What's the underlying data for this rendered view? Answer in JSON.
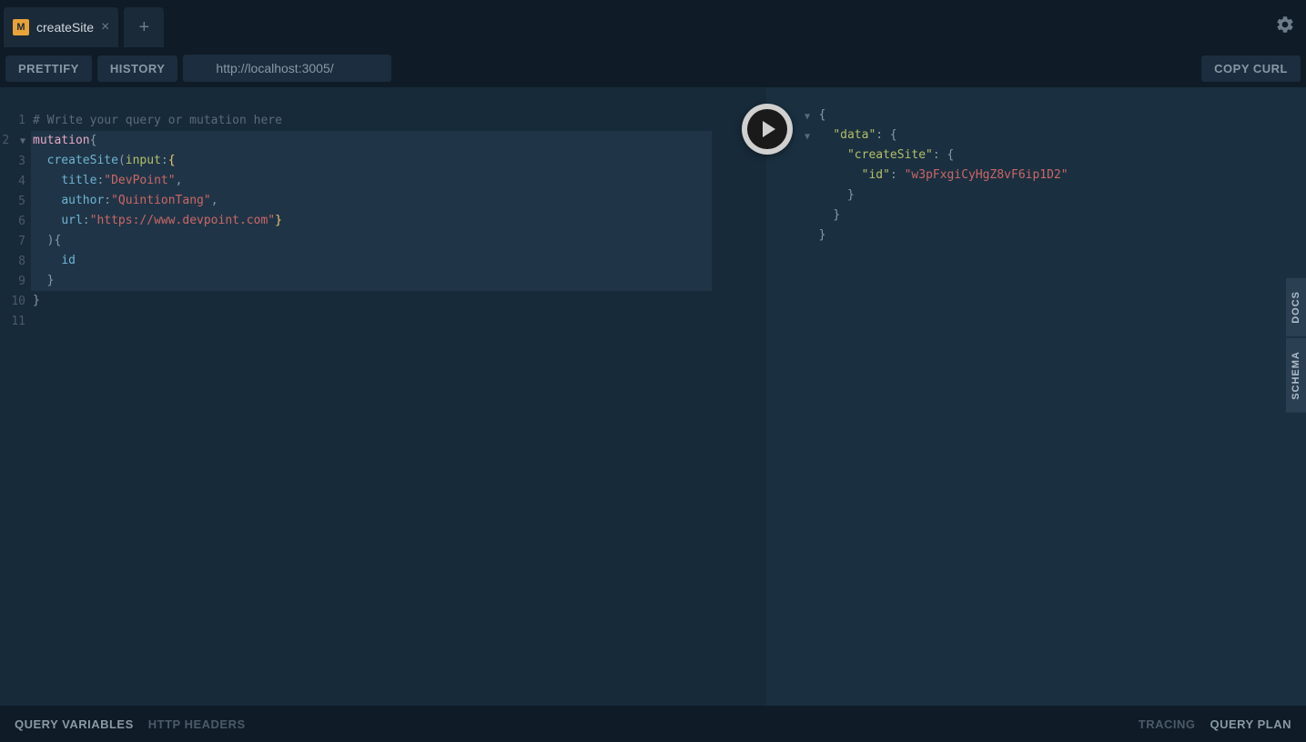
{
  "tabs": {
    "active": {
      "badge": "M",
      "title": "createSite"
    }
  },
  "toolbar": {
    "prettify": "PRETTIFY",
    "history": "HISTORY",
    "endpoint": "http://localhost:3005/",
    "copy_curl": "COPY CURL"
  },
  "editor": {
    "lines": [
      "1",
      "2",
      "3",
      "4",
      "5",
      "6",
      "7",
      "8",
      "9",
      "10",
      "11"
    ],
    "comment": "# Write your query or mutation here",
    "query": {
      "keyword": "mutation",
      "operation": "createSite",
      "param_input": "input",
      "fields": {
        "title_key": "title",
        "title_val": "\"DevPoint\"",
        "author_key": "author",
        "author_val": "\"QuintionTang\"",
        "url_key": "url",
        "url_val": "\"https://www.devpoint.com\"",
        "selection": "id"
      }
    }
  },
  "result": {
    "data_key": "\"data\"",
    "createSite_key": "\"createSite\"",
    "id_key": "\"id\"",
    "id_val": "\"w3pFxgiCyHgZ8vF6ip1D2\""
  },
  "side_tabs": {
    "docs": "DOCS",
    "schema": "SCHEMA"
  },
  "bottom": {
    "query_variables": "QUERY VARIABLES",
    "http_headers": "HTTP HEADERS",
    "tracing": "TRACING",
    "query_plan": "QUERY PLAN"
  }
}
